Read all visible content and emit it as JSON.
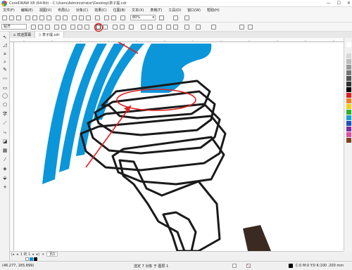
{
  "window": {
    "title": "CorelDRAW X8 (64-Bit) - C:\\Users\\Administrator\\Desktop\\茶子提.cdr",
    "minimize": "—",
    "maximize": "☐",
    "close": "✕"
  },
  "menu": [
    "文件(F)",
    "编辑(E)",
    "视图(V)",
    "布局(L)",
    "对象(C)",
    "效果(C)",
    "位图(B)",
    "文本(X)",
    "表格(T)",
    "工具(O)",
    "窗口(W)",
    "帮助(H)"
  ],
  "toolbar": {
    "zoom_value": "80%"
  },
  "property_bar": {
    "snap_label": "贴齐"
  },
  "tabs": [
    {
      "label": "欢迎屏幕",
      "icon": "home-icon"
    },
    {
      "label": "茶子提.cdr",
      "icon": "document-icon"
    }
  ],
  "page_nav": {
    "first": "|◂",
    "prev": "◂",
    "page_count": "1 的 1",
    "next": "▸",
    "last": "▸|",
    "add": "+",
    "page_tab": "页1"
  },
  "status": {
    "coords": "(46.277, 165.899)",
    "document": "选定 7 对象 于 图层 1",
    "fill_info": "C:0 M:0 Y:0 K:100 .200 mm"
  },
  "colors": {
    "accent": "#0b96d9",
    "stroke": "#1a1a1a",
    "annotation": "#e02020",
    "outline_dots": "#5ac8c8"
  },
  "palette": [
    "#ffffff",
    "#f0f0f0",
    "#d8d8d8",
    "#bcbcbc",
    "#9a9a9a",
    "#777777",
    "#555555",
    "#333333",
    "#000000",
    "#e02020",
    "#f08020",
    "#f0d020",
    "#30b030",
    "#20a0d0",
    "#2050c0",
    "#8030a0",
    "#e050a0",
    "#804020"
  ]
}
